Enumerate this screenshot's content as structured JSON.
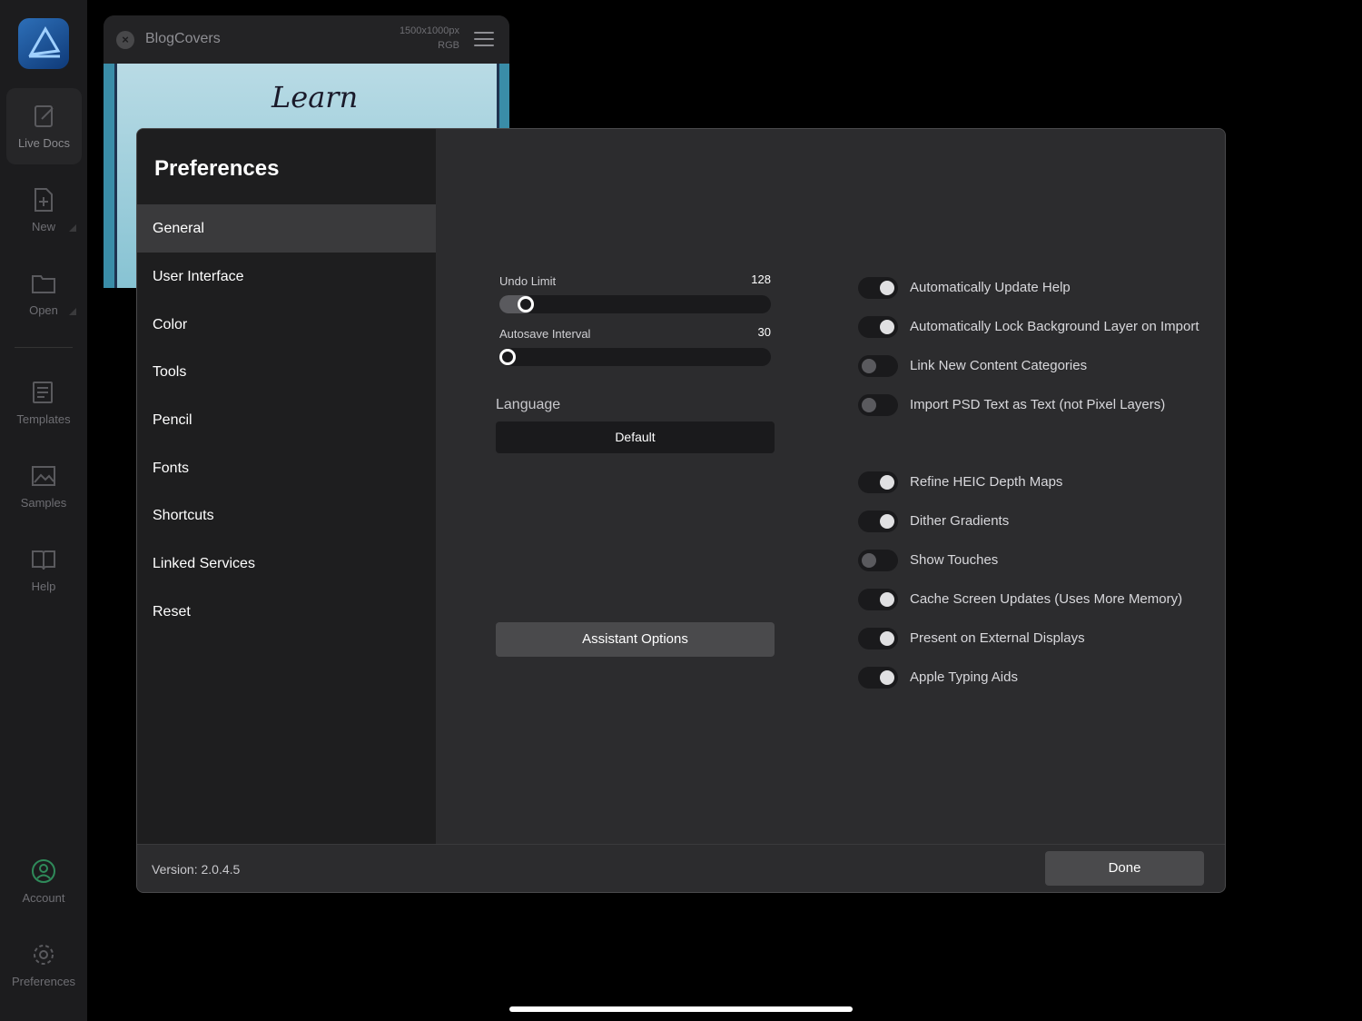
{
  "app_sidebar": {
    "logo_icon": "affinity-designer-logo-icon",
    "items": [
      {
        "label": "Live Docs",
        "icon": "live-docs-icon",
        "active": true
      },
      {
        "label": "New",
        "icon": "new-document-icon"
      },
      {
        "label": "Open",
        "icon": "folder-icon"
      },
      {
        "label": "Templates",
        "icon": "templates-icon"
      },
      {
        "label": "Samples",
        "icon": "samples-icon"
      },
      {
        "label": "Help",
        "icon": "book-icon"
      }
    ],
    "bottom_items": [
      {
        "label": "Account",
        "icon": "account-icon"
      },
      {
        "label": "Preferences",
        "icon": "gear-icon"
      }
    ]
  },
  "document": {
    "title": "BlogCovers",
    "size": "1500x1000px",
    "color_format": "RGB",
    "art_text": "Learn"
  },
  "preferences": {
    "title": "Preferences",
    "sections": [
      "General",
      "User Interface",
      "Color",
      "Tools",
      "Pencil",
      "Fonts",
      "Shortcuts",
      "Linked Services",
      "Reset"
    ],
    "active_section": "General",
    "general": {
      "undo_limit": {
        "label": "Undo Limit",
        "value": "128",
        "fraction": 0.07
      },
      "autosave_interval": {
        "label": "Autosave Interval",
        "value": "30",
        "fraction": 0.0
      },
      "language": {
        "label": "Language",
        "value": "Default"
      },
      "assistant_button": "Assistant Options",
      "toggles": [
        {
          "label": "Automatically Update Help",
          "on": true
        },
        {
          "label": "Automatically Lock Background Layer on Import",
          "on": true
        },
        {
          "label": "Link New Content Categories",
          "on": false
        },
        {
          "label": "Import PSD Text as Text (not Pixel Layers)",
          "on": false
        },
        {
          "label": "Refine HEIC Depth Maps",
          "on": true
        },
        {
          "label": "Dither Gradients",
          "on": true
        },
        {
          "label": "Show Touches",
          "on": false
        },
        {
          "label": "Cache Screen Updates (Uses More Memory)",
          "on": true
        },
        {
          "label": "Present on External Displays",
          "on": true
        },
        {
          "label": "Apple Typing Aids",
          "on": true
        }
      ]
    },
    "footer": {
      "version": "Version: 2.0.4.5",
      "done_label": "Done"
    }
  }
}
